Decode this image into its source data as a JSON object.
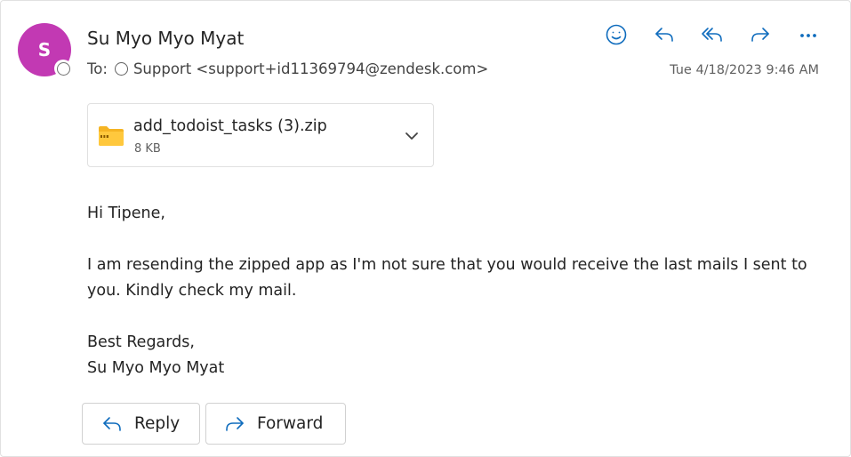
{
  "message": {
    "sender_initial": "S",
    "sender_name": "Su Myo Myo Myat",
    "to_label": "To:",
    "recipient": "Support <support+id11369794@zendesk.com>",
    "timestamp": "Tue 4/18/2023 9:46 AM"
  },
  "header_actions": [
    {
      "icon": "emoji-icon"
    },
    {
      "icon": "reply-icon"
    },
    {
      "icon": "reply-all-icon"
    },
    {
      "icon": "forward-icon"
    },
    {
      "icon": "more-icon"
    }
  ],
  "attachment": {
    "icon": "zip-folder-icon",
    "name": "add_todoist_tasks (3).zip",
    "size": "8 KB"
  },
  "body": {
    "greeting": "Hi Tipene,",
    "paragraph": "I am resending the zipped app as I'm not sure that you would receive the last mails I sent to you. Kindly check my mail.",
    "closing": "Best Regards,",
    "signature": "Su Myo Myo Myat"
  },
  "footer": {
    "reply_label": "Reply",
    "forward_label": "Forward"
  },
  "colors": {
    "avatar": "#c239b3",
    "accent": "#0f6cbd",
    "zip_folder": "#f5b423"
  }
}
